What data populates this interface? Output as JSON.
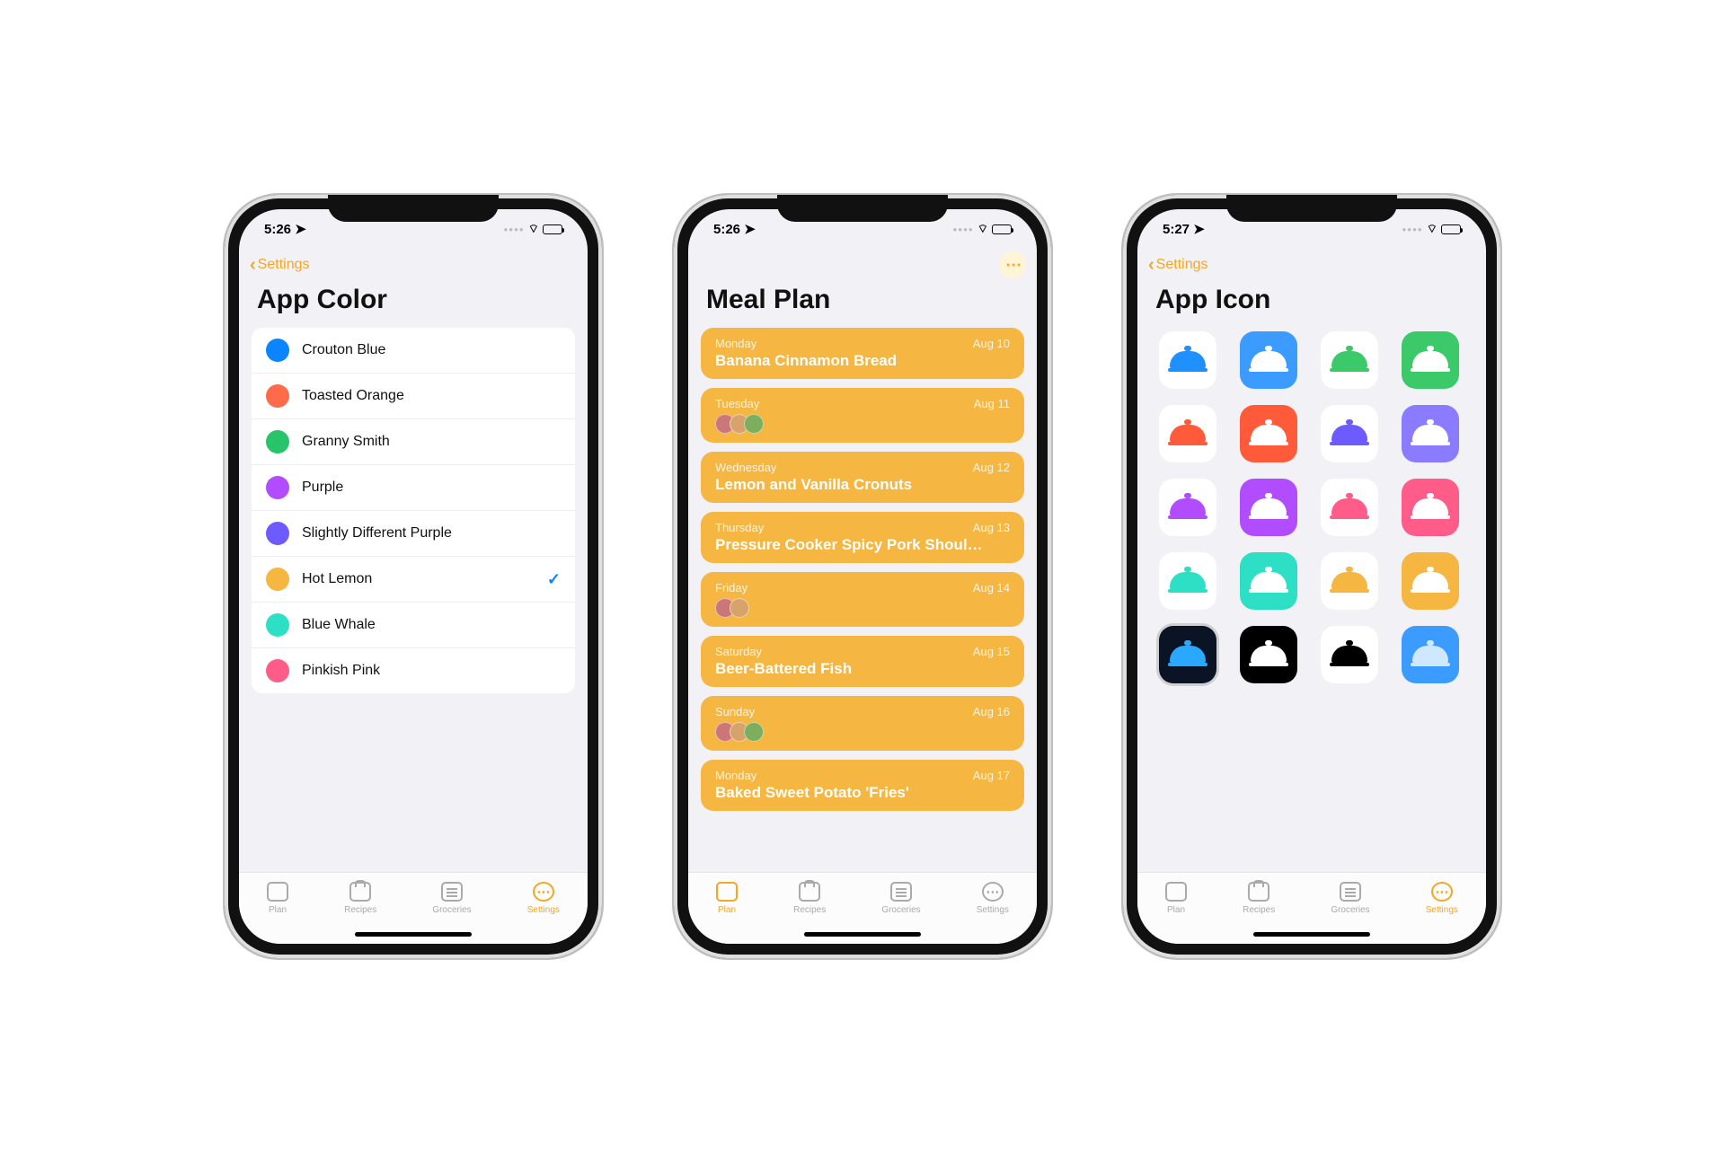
{
  "phone1": {
    "time": "5:26",
    "back": "Settings",
    "title": "App Color",
    "colors": [
      {
        "name": "Crouton Blue",
        "hex": "#0a84ff",
        "selected": false
      },
      {
        "name": "Toasted Orange",
        "hex": "#ff6b4a",
        "selected": false
      },
      {
        "name": "Granny Smith",
        "hex": "#28c46a",
        "selected": false
      },
      {
        "name": "Purple",
        "hex": "#b24dff",
        "selected": false
      },
      {
        "name": "Slightly Different Purple",
        "hex": "#6e5bff",
        "selected": false
      },
      {
        "name": "Hot Lemon",
        "hex": "#f5b642",
        "selected": true
      },
      {
        "name": "Blue Whale",
        "hex": "#2de0c5",
        "selected": false
      },
      {
        "name": "Pinkish Pink",
        "hex": "#ff5c8a",
        "selected": false
      }
    ]
  },
  "phone2": {
    "time": "5:26",
    "title": "Meal Plan",
    "accent": "#f5b642",
    "days": [
      {
        "day": "Monday",
        "date": "Aug 10",
        "meal": "Banana Cinnamon Bread"
      },
      {
        "day": "Tuesday",
        "date": "Aug 11",
        "thumbs": 3
      },
      {
        "day": "Wednesday",
        "date": "Aug 12",
        "meal": "Lemon and Vanilla Cronuts"
      },
      {
        "day": "Thursday",
        "date": "Aug 13",
        "meal": "Pressure Cooker Spicy Pork Shoul…"
      },
      {
        "day": "Friday",
        "date": "Aug 14",
        "thumbs": 2
      },
      {
        "day": "Saturday",
        "date": "Aug 15",
        "meal": "Beer-Battered Fish"
      },
      {
        "day": "Sunday",
        "date": "Aug 16",
        "thumbs": 3
      },
      {
        "day": "Monday",
        "date": "Aug 17",
        "meal": "Baked Sweet Potato 'Fries'"
      }
    ]
  },
  "phone3": {
    "time": "5:27",
    "back": "Settings",
    "title": "App Icon",
    "icons": [
      {
        "bg": "#ffffff",
        "fg": "#1e90ff"
      },
      {
        "bg": "#3b9bff",
        "fg": "#ffffff"
      },
      {
        "bg": "#ffffff",
        "fg": "#3cc96a"
      },
      {
        "bg": "#3cc96a",
        "fg": "#ffffff"
      },
      {
        "bg": "#ffffff",
        "fg": "#ff5b3a"
      },
      {
        "bg": "#ff5b3a",
        "fg": "#ffffff"
      },
      {
        "bg": "#ffffff",
        "fg": "#6e5bff"
      },
      {
        "bg": "#8b7bff",
        "fg": "#ffffff"
      },
      {
        "bg": "#ffffff",
        "fg": "#b24dff"
      },
      {
        "bg": "#b24dff",
        "fg": "#ffffff"
      },
      {
        "bg": "#ffffff",
        "fg": "#ff5c8a"
      },
      {
        "bg": "#ff5c8a",
        "fg": "#ffffff"
      },
      {
        "bg": "#ffffff",
        "fg": "#2de0c5"
      },
      {
        "bg": "#2de0c5",
        "fg": "#ffffff"
      },
      {
        "bg": "#ffffff",
        "fg": "#f5b642"
      },
      {
        "bg": "#f5b642",
        "fg": "#ffffff"
      },
      {
        "bg": "#0b1424",
        "fg": "#2aa7ff",
        "selected": true
      },
      {
        "bg": "#000000",
        "fg": "#ffffff"
      },
      {
        "bg": "#ffffff",
        "fg": "#000000"
      },
      {
        "bg": "#3b9bff",
        "fg": "#cfe7ff"
      }
    ]
  },
  "tabs": [
    {
      "id": "plan",
      "label": "Plan"
    },
    {
      "id": "recipes",
      "label": "Recipes"
    },
    {
      "id": "groceries",
      "label": "Groceries"
    },
    {
      "id": "settings",
      "label": "Settings"
    }
  ]
}
